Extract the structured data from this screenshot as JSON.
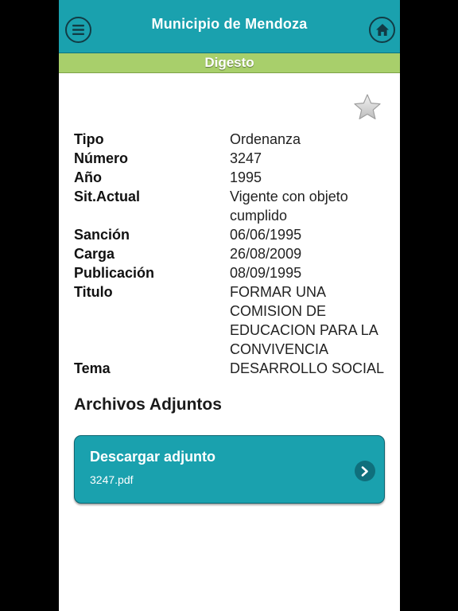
{
  "header": {
    "title": "Municipio de Mendoza",
    "menu_icon": "hamburger-menu-icon",
    "home_icon": "home-icon",
    "color": "#1aa1ae"
  },
  "subheader": {
    "title": "Digesto",
    "color": "#a8cf6b"
  },
  "favorite_icon": "star-icon",
  "details": [
    {
      "label": "Tipo",
      "value": "Ordenanza"
    },
    {
      "label": "Número",
      "value": "3247"
    },
    {
      "label": "Año",
      "value": "1995"
    },
    {
      "label": "Sit.Actual",
      "value": "Vigente con objeto cumplido"
    },
    {
      "label": "Sanción",
      "value": "06/06/1995"
    },
    {
      "label": "Carga",
      "value": "26/08/2009"
    },
    {
      "label": "Publicación",
      "value": "08/09/1995"
    },
    {
      "label": "Titulo",
      "value": "FORMAR UNA COMISION DE EDUCACION PARA LA CONVIVENCIA"
    },
    {
      "label": "Tema",
      "value": "DESARROLLO SOCIAL"
    }
  ],
  "attachments": {
    "section_title": "Archivos Adjuntos",
    "items": [
      {
        "title": "Descargar adjunto",
        "filename": "3247.pdf",
        "icon": "chevron-right-icon"
      }
    ]
  }
}
